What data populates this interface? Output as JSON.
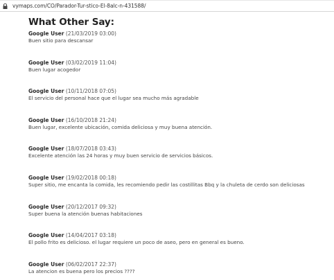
{
  "browser": {
    "url": "vymaps.com/CO/Parador-Tur-stico-El-8alc-n-431588/"
  },
  "page": {
    "title": "What Other Say:"
  },
  "reviews": [
    {
      "author": "Google User",
      "date": "(21/03/2019 03:00)",
      "text": "Buen sitio para descansar"
    },
    {
      "author": "Google User",
      "date": "(03/02/2019 11:04)",
      "text": "Buen lugar acogedor"
    },
    {
      "author": "Google User",
      "date": "(10/11/2018 07:05)",
      "text": "El servicio del personal hace que el lugar sea mucho más agradable"
    },
    {
      "author": "Google User",
      "date": "(16/10/2018 21:24)",
      "text": "Buen lugar, excelente ubicación, comida deliciosa y muy buena atención."
    },
    {
      "author": "Google User",
      "date": "(18/07/2018 03:43)",
      "text": "Excelente atención las 24 horas y muy buen servicio de servicios básicos."
    },
    {
      "author": "Google User",
      "date": "(19/02/2018 00:18)",
      "text": "Super sitio, me encanta la comida, les recomiendo pedir las costillitas Bbq y la chuleta de cerdo son deliciosas"
    },
    {
      "author": "Google User",
      "date": "(20/12/2017 09:32)",
      "text": "Super buena la atención buenas habitaciones"
    },
    {
      "author": "Google User",
      "date": "(14/04/2017 03:18)",
      "text": "El pollo frito es delicioso. el lugar requiere un poco de aseo, pero en general es bueno."
    },
    {
      "author": "Google User",
      "date": "(06/02/2017 22:37)",
      "text": "La atencion es buena pero los precios ????"
    }
  ]
}
